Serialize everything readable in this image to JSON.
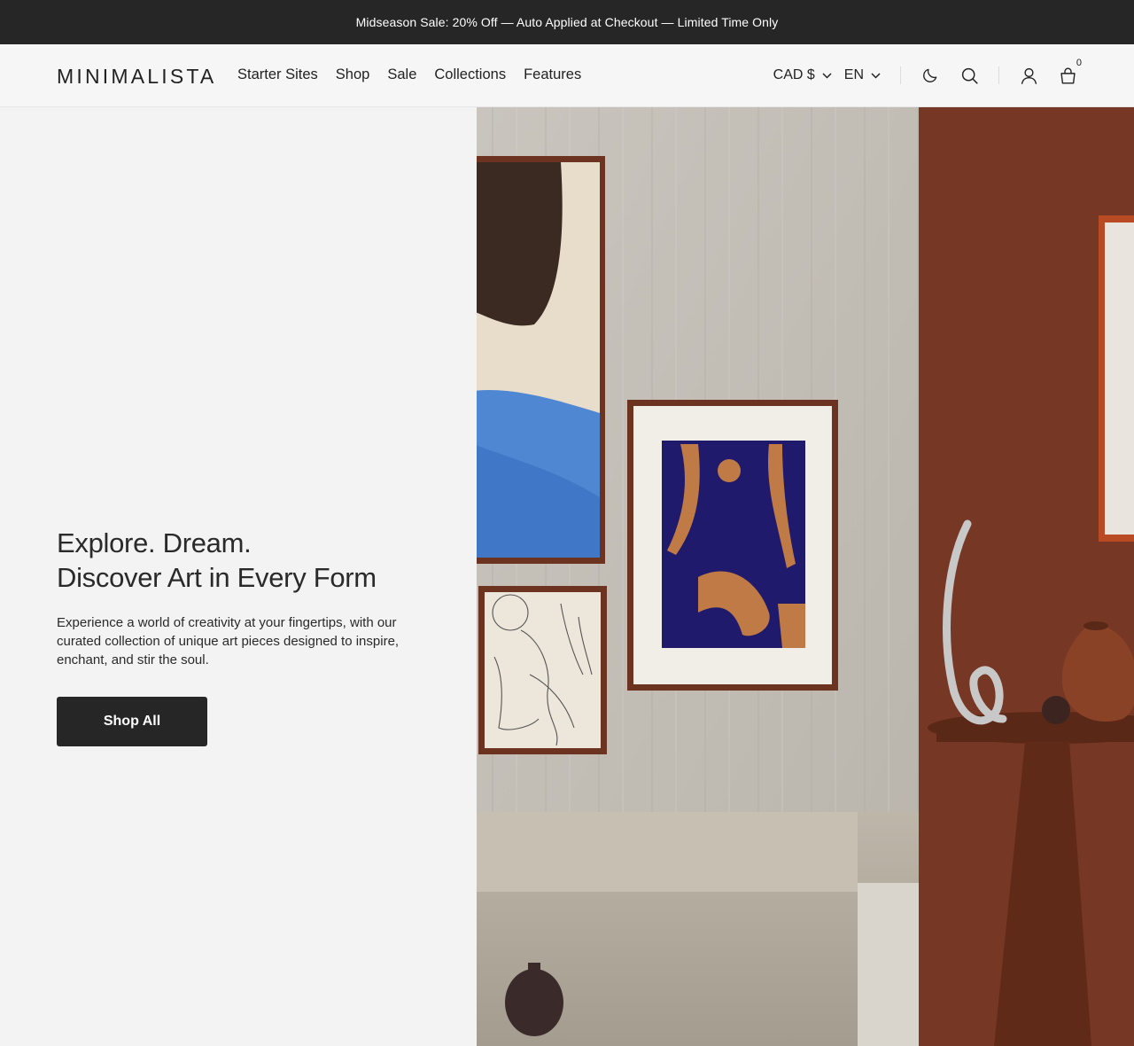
{
  "announcement": "Midseason Sale: 20% Off — Auto Applied at Checkout — Limited Time Only",
  "header": {
    "logo": "MINIMALISTA",
    "nav": [
      "Starter Sites",
      "Shop",
      "Sale",
      "Collections",
      "Features"
    ],
    "currency": "CAD $",
    "language": "EN",
    "cart_count": "0",
    "icons": [
      "chevron-down-icon",
      "moon-icon",
      "search-icon",
      "account-icon",
      "cart-icon"
    ]
  },
  "hero": {
    "headline_line1": "Explore. Dream.",
    "headline_line2": "Discover Art in Every Form",
    "description": "Experience a world of creativity at your fingertips, with our curated collection of unique art pieces designed to inspire, enchant, and stir the soul.",
    "cta_label": "Shop All"
  },
  "colors": {
    "announcement_bg": "#262626",
    "button_bg": "#262626",
    "page_bg": "#f3f3f3",
    "accent_terracotta": "#7a3a26"
  }
}
